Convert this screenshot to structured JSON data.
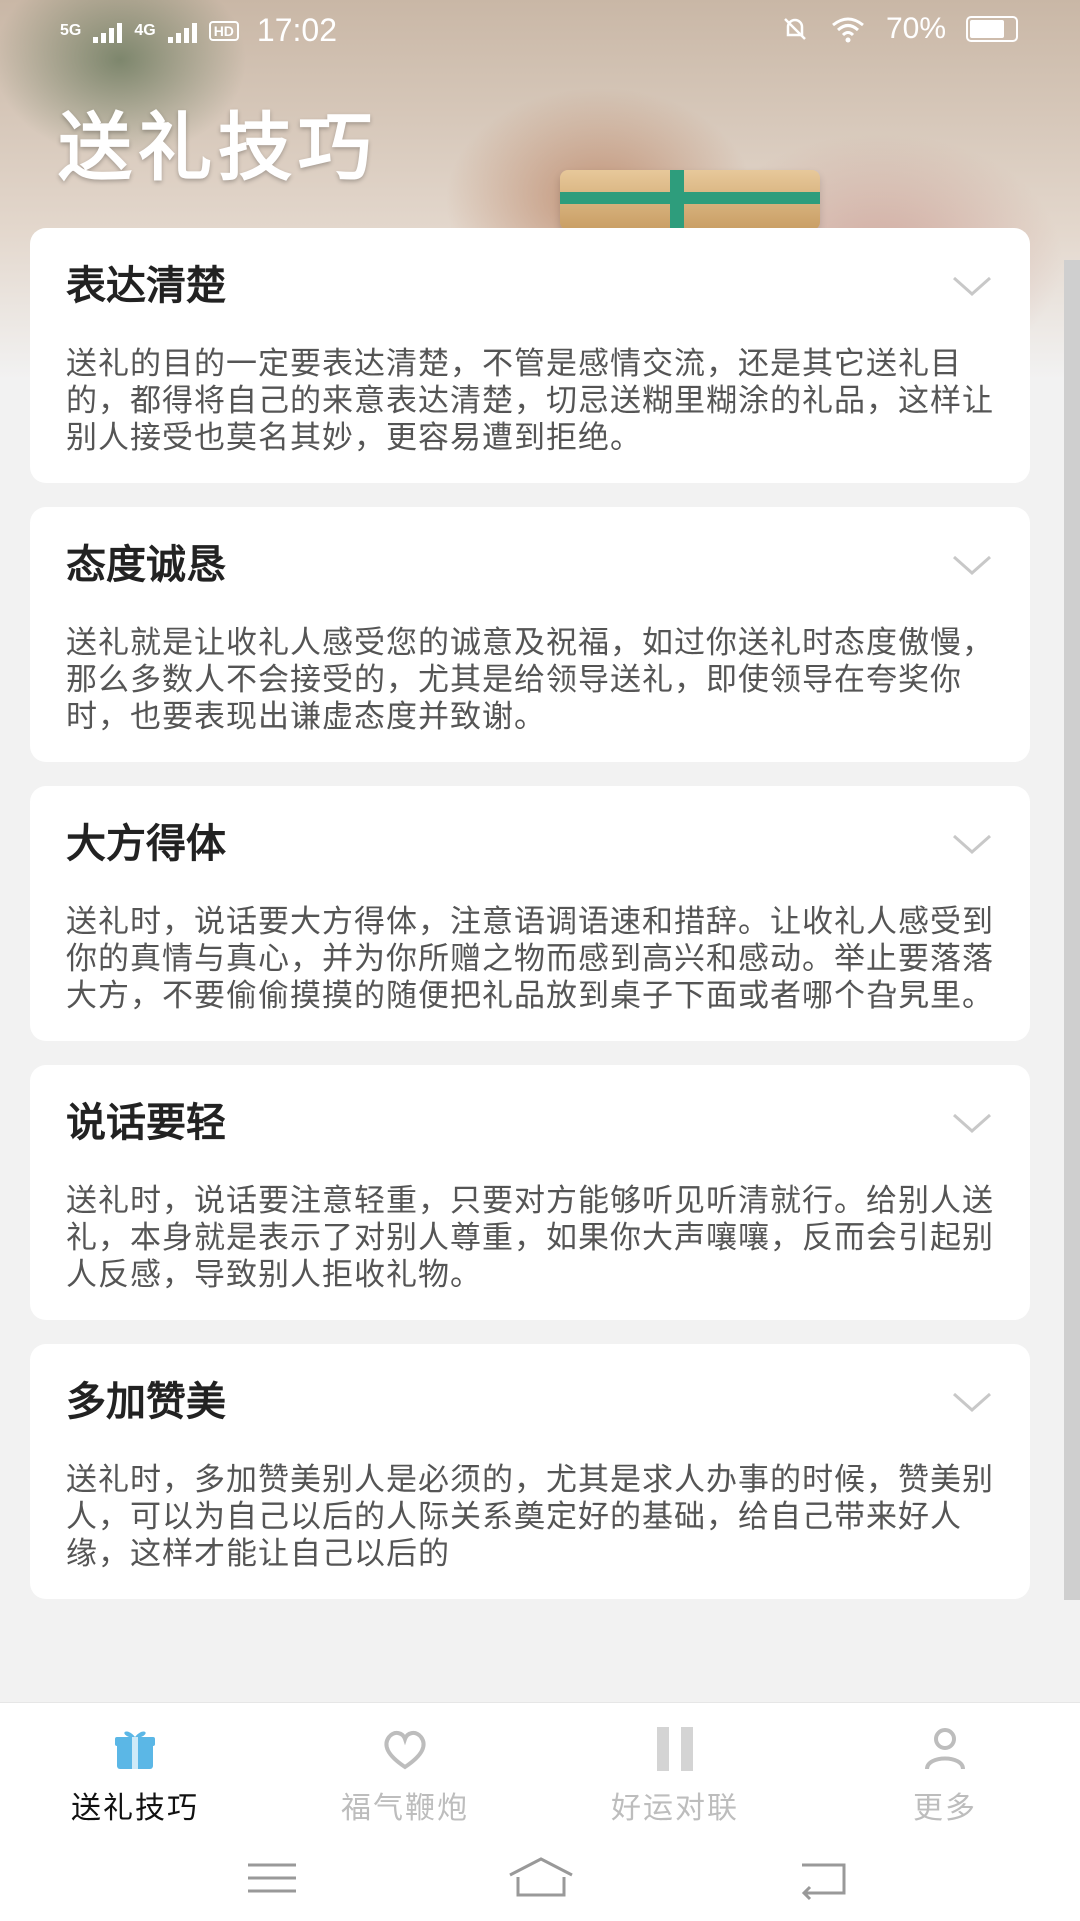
{
  "status_bar": {
    "net1": "5G",
    "net2": "4G",
    "hd": "HD",
    "time": "17:02",
    "battery": "70%"
  },
  "header": {
    "title": "送礼技巧"
  },
  "cards": [
    {
      "title": "表达清楚",
      "body": "送礼的目的一定要表达清楚，不管是感情交流，还是其它送礼目的，都得将自己的来意表达清楚，切忌送糊里糊涂的礼品，这样让别人接受也莫名其妙，更容易遭到拒绝。"
    },
    {
      "title": "态度诚恳",
      "body": "送礼就是让收礼人感受您的诚意及祝福，如过你送礼时态度傲慢，那么多数人不会接受的，尤其是给领导送礼，即使领导在夸奖你时，也要表现出谦虚态度并致谢。"
    },
    {
      "title": "大方得体",
      "body": "送礼时，说话要大方得体，注意语调语速和措辞。让收礼人感受到你的真情与真心，并为你所赠之物而感到高兴和感动。举止要落落大方，不要偷偷摸摸的随便把礼品放到桌子下面或者哪个旮旯里。"
    },
    {
      "title": "说话要轻",
      "body": "送礼时，说话要注意轻重，只要对方能够听见听清就行。给别人送礼，本身就是表示了对别人尊重，如果你大声嚷嚷，反而会引起别人反感，导致别人拒收礼物。"
    },
    {
      "title": "多加赞美",
      "body": "送礼时，多加赞美别人是必须的，尤其是求人办事的时候，赞美别人，可以为自己以后的人际关系奠定好的基础，给自己带来好人缘，这样才能让自己以后的"
    }
  ],
  "bottom_nav": [
    {
      "label": "送礼技巧",
      "icon": "gift-icon",
      "active": true
    },
    {
      "label": "福气鞭炮",
      "icon": "heart-icon",
      "active": false
    },
    {
      "label": "好运对联",
      "icon": "couplet-icon",
      "active": false
    },
    {
      "label": "更多",
      "icon": "person-icon",
      "active": false
    }
  ],
  "colors": {
    "active_icon": "#5bb7e6",
    "inactive": "#bdbdbd"
  }
}
